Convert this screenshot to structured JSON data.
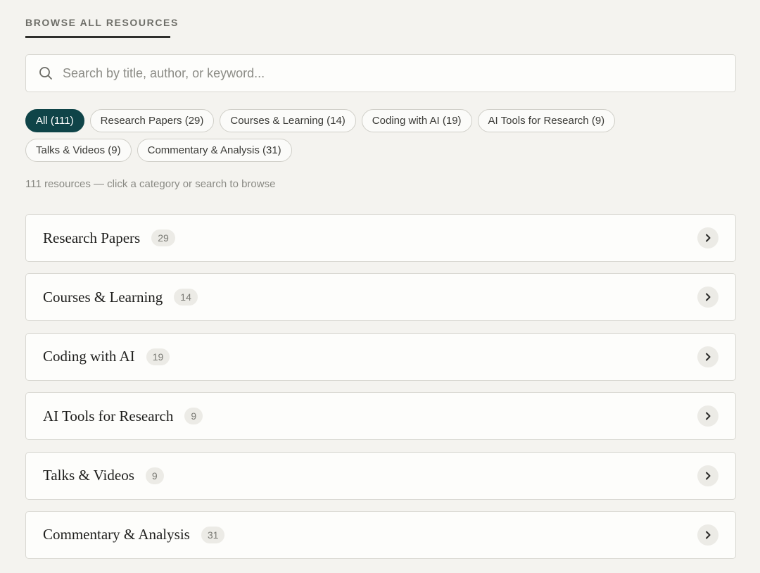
{
  "section": {
    "title": "BROWSE ALL RESOURCES"
  },
  "search": {
    "placeholder": "Search by title, author, or keyword...",
    "value": ""
  },
  "filters": {
    "row1": [
      {
        "label": "All (111)",
        "active": true
      },
      {
        "label": "Research Papers (29)",
        "active": false
      },
      {
        "label": "Courses & Learning (14)",
        "active": false
      },
      {
        "label": "Coding with AI (19)",
        "active": false
      },
      {
        "label": "AI Tools for Research (9)",
        "active": false
      }
    ],
    "row2": [
      {
        "label": "Talks & Videos (9)",
        "active": false
      },
      {
        "label": "Commentary & Analysis (31)",
        "active": false
      }
    ]
  },
  "summary": "111 resources — click a category or search to browse",
  "categories": [
    {
      "title": "Research Papers",
      "count": "29"
    },
    {
      "title": "Courses & Learning",
      "count": "14"
    },
    {
      "title": "Coding with AI",
      "count": "19"
    },
    {
      "title": "AI Tools for Research",
      "count": "9"
    },
    {
      "title": "Talks & Videos",
      "count": "9"
    },
    {
      "title": "Commentary & Analysis",
      "count": "31"
    }
  ],
  "colors": {
    "accent": "#0f4448",
    "background": "#f4f3ef"
  },
  "icons": {
    "search": "search-icon",
    "chevron": "chevron-right-icon"
  }
}
